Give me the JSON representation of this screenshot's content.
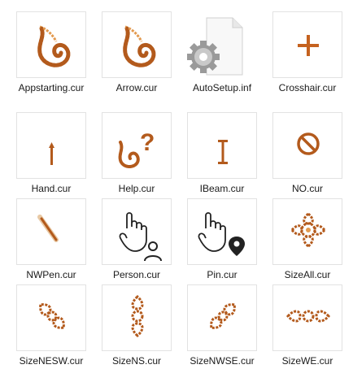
{
  "files": [
    {
      "name": "Appstarting.cur",
      "icon": "swirl-leaf-cursor-icon"
    },
    {
      "name": "Arrow.cur",
      "icon": "swirl-leaf-cursor-icon"
    },
    {
      "name": "AutoSetup.inf",
      "icon": "settings-file-icon"
    },
    {
      "name": "Crosshair.cur",
      "icon": "crosshair-cursor-icon"
    },
    {
      "name": "Hand.cur",
      "icon": "up-arrow-cursor-icon"
    },
    {
      "name": "Help.cur",
      "icon": "help-cursor-icon"
    },
    {
      "name": "IBeam.cur",
      "icon": "ibeam-cursor-icon"
    },
    {
      "name": "NO.cur",
      "icon": "no-cursor-icon"
    },
    {
      "name": "NWPen.cur",
      "icon": "pen-cursor-icon"
    },
    {
      "name": "Person.cur",
      "icon": "person-select-cursor-icon"
    },
    {
      "name": "Pin.cur",
      "icon": "pin-select-cursor-icon"
    },
    {
      "name": "SizeAll.cur",
      "icon": "size-all-cursor-icon"
    },
    {
      "name": "SizeNESW.cur",
      "icon": "size-nesw-cursor-icon"
    },
    {
      "name": "SizeNS.cur",
      "icon": "size-ns-cursor-icon"
    },
    {
      "name": "SizeNWSE.cur",
      "icon": "size-nwse-cursor-icon"
    },
    {
      "name": "SizeWE.cur",
      "icon": "size-we-cursor-icon"
    }
  ],
  "colors": {
    "cursor_brown": "#b35a1c",
    "cursor_light": "#e39a4f",
    "border": "#e2e2e2"
  }
}
